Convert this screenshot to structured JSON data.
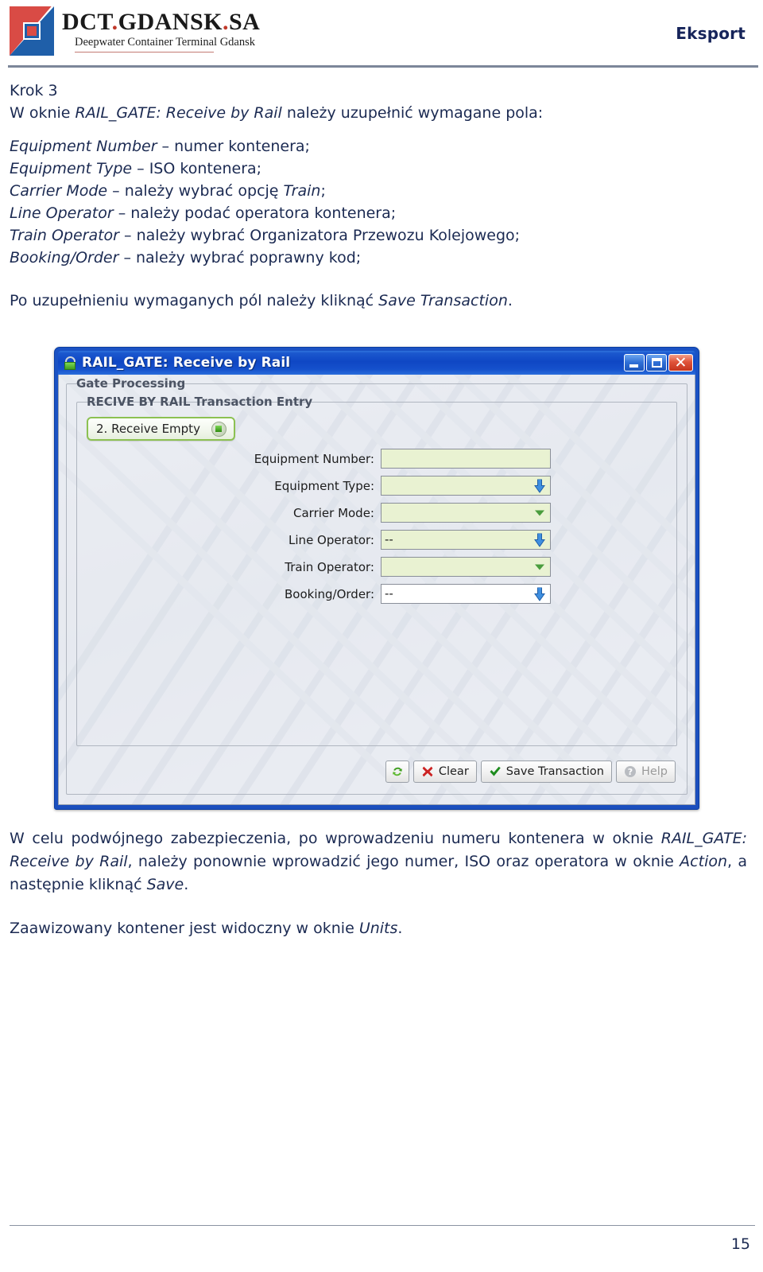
{
  "header": {
    "logo_title_parts": [
      "DCT",
      ".",
      "GDANSK",
      ".",
      "SA"
    ],
    "logo_title": "DCT.GDANSK.SA",
    "logo_subtitle": "Deepwater Container Terminal Gdansk",
    "section_label": "Eksport"
  },
  "body": {
    "step_heading": "Krok 3",
    "intro_prefix": "W oknie ",
    "intro_window": "RAIL_GATE: Receive by Rail",
    "intro_suffix": " należy uzupełnić wymagane pola:",
    "fields": [
      {
        "name": "Equipment Number",
        "desc": " – numer kontenera;"
      },
      {
        "name": "Equipment Type",
        "desc": " – ISO kontenera;"
      },
      {
        "name": "Carrier Mode",
        "desc_before": " – należy wybrać opcję ",
        "emphasis": "Train",
        "desc_after": ";"
      },
      {
        "name": "Line Operator",
        "desc": " – należy podać operatora kontenera;"
      },
      {
        "name": "Train Operator",
        "desc": " – należy wybrać Organizatora Przewozu Kolejowego;"
      },
      {
        "name": "Booking/Order",
        "desc": " – należy wybrać poprawny kod;"
      }
    ],
    "save_note_prefix": "Po uzupełnieniu wymaganych pól należy kliknąć ",
    "save_note_emphasis": "Save Transaction",
    "save_note_suffix": ".",
    "closing_para_1_a": "W celu podwójnego zabezpieczenia, po wprowadzeniu numeru kontenera w oknie ",
    "closing_para_1_em1": "RAIL_GATE: Receive by Rail",
    "closing_para_1_b": ", należy ponownie wprowadzić jego numer, ISO oraz operatora w oknie ",
    "closing_para_1_em2": "Action",
    "closing_para_1_c": ", a następnie kliknąć ",
    "closing_para_1_em3": "Save",
    "closing_para_1_d": ".",
    "closing_para_2_a": "Zaawizowany kontener jest widoczny w oknie ",
    "closing_para_2_em": "Units",
    "closing_para_2_b": "."
  },
  "dialog": {
    "title": "RAIL_GATE: Receive by Rail",
    "title_icon": "padlock-icon",
    "window_controls": {
      "minimize": "–",
      "maximize": "□",
      "close": "✕"
    },
    "group_outer_legend": "Gate Processing",
    "group_inner_legend": "RECIVE BY RAIL Transaction Entry",
    "mode_button_label": "2. Receive Empty",
    "form_rows": [
      {
        "label": "Equipment Number:",
        "value": "",
        "control": "text",
        "bg": "green"
      },
      {
        "label": "Equipment Type:",
        "value": "",
        "control": "lookup-arrow",
        "bg": "green"
      },
      {
        "label": "Carrier Mode:",
        "value": "",
        "control": "dropdown-caret",
        "bg": "green"
      },
      {
        "label": "Line Operator:",
        "value": "--",
        "control": "lookup-arrow",
        "bg": "green"
      },
      {
        "label": "Train Operator:",
        "value": "",
        "control": "dropdown-caret",
        "bg": "green"
      },
      {
        "label": "Booking/Order:",
        "value": "--",
        "control": "lookup-arrow",
        "bg": "white"
      }
    ],
    "buttons": [
      {
        "label": "",
        "icon": "refresh-icon",
        "disabled": false
      },
      {
        "label": "Clear",
        "icon": "red-x-icon",
        "disabled": false
      },
      {
        "label": "Save Transaction",
        "icon": "green-check-icon",
        "disabled": false
      },
      {
        "label": "Help",
        "icon": "question-mark-icon",
        "disabled": true
      }
    ]
  },
  "footer": {
    "page_number": "15"
  },
  "colors": {
    "text": "#1b2a52",
    "titlebar_blue": "#0f47c4",
    "field_green": "#e9f2d2",
    "accent_red": "#c0392b",
    "accent_blue": "#1f5fa9"
  }
}
